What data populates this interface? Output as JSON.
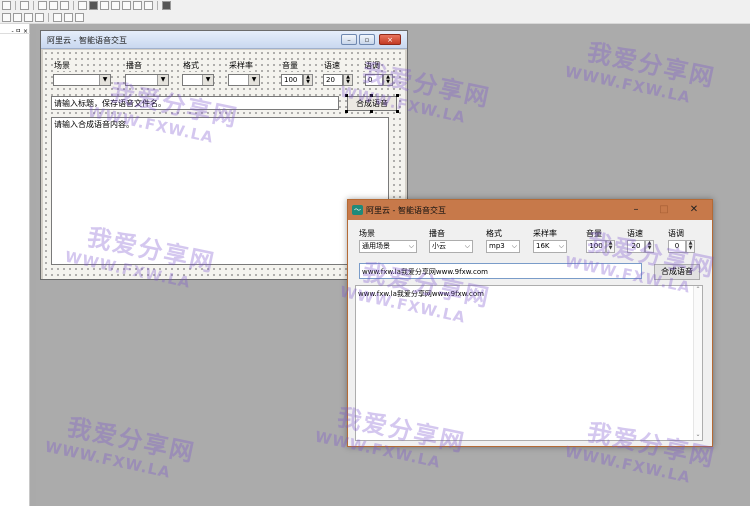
{
  "ide": {
    "panel_header": "- ㅁ ×"
  },
  "designer_window": {
    "title": "阿里云 - 智能语音交互",
    "labels": {
      "scene": "场景",
      "voice": "播音",
      "format": "格式",
      "sample_rate": "采样率",
      "volume": "音量",
      "speed": "语速",
      "pitch": "语调"
    },
    "volume_value": "100",
    "speed_value": "20",
    "pitch_value": "0",
    "title_input": "请输入标题，保存语音文件名。",
    "synth_button": "合成语音",
    "content_input": "请输入合成语音内容。"
  },
  "app_window": {
    "title": "阿里云 - 智能语音交互",
    "labels": {
      "scene": "场景",
      "voice": "播音",
      "format": "格式",
      "sample_rate": "采样率",
      "volume": "音量",
      "speed": "语速",
      "pitch": "语调"
    },
    "scene_value": "通用场景",
    "voice_value": "小云",
    "format_value": "mp3",
    "sample_rate_value": "16K",
    "volume_value": "100",
    "speed_value": "20",
    "pitch_value": "0",
    "title_input": "www.fxw.la我爱分享网www.9fxw.com",
    "synth_button": "合成语音",
    "content_input": "www.fxw.la我爱分享网www.9fxw.com"
  },
  "watermark": {
    "text_cn": "我爱分享网",
    "text_url": "WWW.FXW.LA"
  },
  "colors": {
    "app_titlebar": "#c7794a",
    "designer_titlebar": "#dce6f6",
    "watermark": "#7a50cd"
  }
}
